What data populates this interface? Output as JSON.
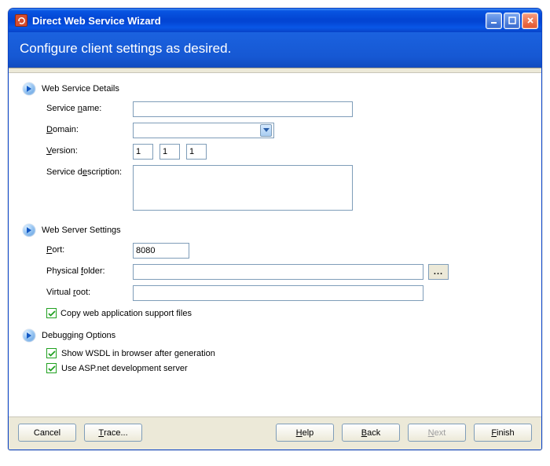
{
  "window": {
    "title": "Direct Web Service Wizard"
  },
  "header": {
    "title": "Configure client settings as desired."
  },
  "sections": {
    "details": {
      "title": "Web Service Details",
      "service_name_label_pre": "Service ",
      "service_name_label_u": "n",
      "service_name_label_post": "ame:",
      "service_name_value": "",
      "domain_label_u": "D",
      "domain_label_post": "omain:",
      "domain_value": "",
      "version_label_u": "V",
      "version_label_post": "ersion:",
      "version": {
        "major": "1",
        "minor": "1",
        "patch": "1"
      },
      "desc_label_pre": "Service d",
      "desc_label_u": "e",
      "desc_label_post": "scription:",
      "desc_value": ""
    },
    "server": {
      "title": "Web Server Settings",
      "port_label_u": "P",
      "port_label_post": "ort:",
      "port_value": "8080",
      "folder_label_pre": "Physical ",
      "folder_label_u": "f",
      "folder_label_post": "older:",
      "folder_value": "",
      "vroot_label_pre": "Virtual ",
      "vroot_label_u": "r",
      "vroot_label_post": "oot:",
      "vroot_value": "",
      "copy_label_u": "C",
      "copy_label_post": "opy web application support files"
    },
    "debug": {
      "title": "Debugging Options",
      "wsdl_label_pre": "Show ",
      "wsdl_label_u": "W",
      "wsdl_label_post": "SDL in browser after generation",
      "aspnet_label_u": "U",
      "aspnet_label_post": "se ASP.net development server"
    }
  },
  "buttons": {
    "cancel": "Cancel",
    "trace_u": "T",
    "trace_post": "race...",
    "help_u": "H",
    "help_post": "elp",
    "back_u": "B",
    "back_post": "ack",
    "next_u": "N",
    "next_post": "ext",
    "finish_u": "F",
    "finish_post": "inish"
  }
}
